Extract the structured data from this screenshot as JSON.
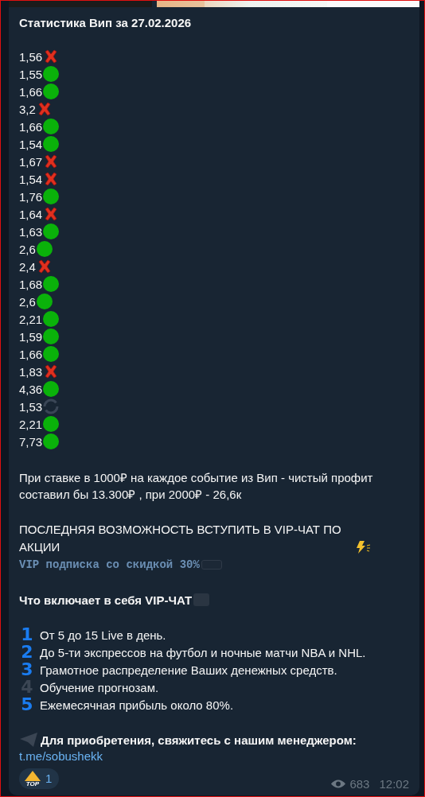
{
  "title": "Статистика Вип за 27.02.2026",
  "results": [
    {
      "odds": "1,56",
      "kind": "loss"
    },
    {
      "odds": "1,55",
      "kind": "win"
    },
    {
      "odds": "1,66",
      "kind": "win"
    },
    {
      "odds": "3,2",
      "kind": "loss"
    },
    {
      "odds": "1,66",
      "kind": "win"
    },
    {
      "odds": "1,54",
      "kind": "win"
    },
    {
      "odds": "1,67",
      "kind": "loss"
    },
    {
      "odds": "1,54",
      "kind": "loss"
    },
    {
      "odds": "1,76",
      "kind": "win"
    },
    {
      "odds": "1,64",
      "kind": "loss"
    },
    {
      "odds": "1,63",
      "kind": "win"
    },
    {
      "odds": "2,6",
      "kind": "win"
    },
    {
      "odds": "2,4",
      "kind": "loss"
    },
    {
      "odds": "1,68",
      "kind": "win"
    },
    {
      "odds": "2,6",
      "kind": "win"
    },
    {
      "odds": "2,21",
      "kind": "win"
    },
    {
      "odds": "1,59",
      "kind": "win"
    },
    {
      "odds": "1,66",
      "kind": "win"
    },
    {
      "odds": "1,83",
      "kind": "loss"
    },
    {
      "odds": "4,36",
      "kind": "win"
    },
    {
      "odds": "1,53",
      "kind": "pending"
    },
    {
      "odds": "2,21",
      "kind": "win"
    },
    {
      "odds": "7,73",
      "kind": "win"
    }
  ],
  "profit_text": "При ставке в 1000₽ на каждое событие из Вип - чистый профит составил бы 13.300₽ , при 2000₽ - 26,6к",
  "offer_heading": "ПОСЛЕДНЯЯ ВОЗМОЖНОСТЬ ВСТУПИТЬ В VIP-ЧАТ ПО АКЦИИ",
  "offer_code": "VIP подписка со скидкой 30%",
  "includes_heading": "Что включает в себя VIP-ЧАТ",
  "features": [
    {
      "number": "1",
      "color": "#1a7cf0",
      "text": "От 5 до 15 Live в день."
    },
    {
      "number": "2",
      "color": "#1a7cf0",
      "text": "До 5-ти экспрессов на футбол и ночные матчи NBA и NHL."
    },
    {
      "number": "3",
      "color": "#1a7cf0",
      "text": "Грамотное распределение Ваших денежных средств."
    },
    {
      "number": "4",
      "color": "#3b4654",
      "text": "Обучение прогнозам."
    },
    {
      "number": "5",
      "color": "#1a7cf0",
      "text": "Ежемесячная прибыль около 80%."
    }
  ],
  "contact_text": "Для приобретения, свяжитесь с нашим менеджером:",
  "contact_link": "t.me/sobushekk",
  "reaction": {
    "badge": "TOP",
    "count": "1"
  },
  "views": "683",
  "time": "12:02"
}
